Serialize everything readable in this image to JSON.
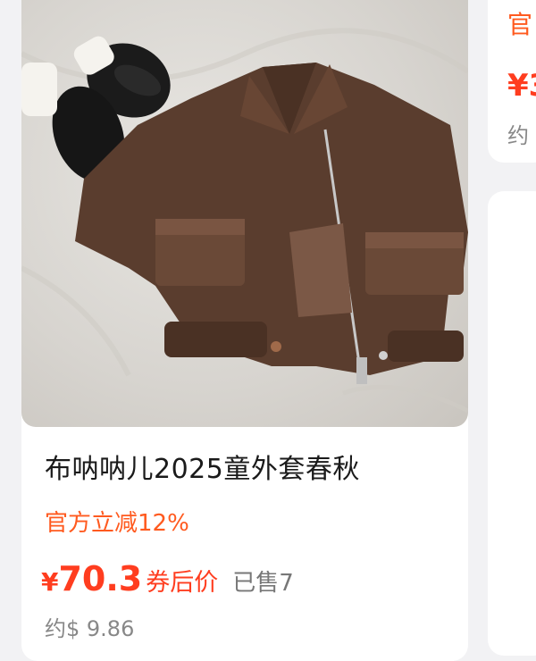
{
  "product": {
    "title": "布呐呐儿2025童外套春秋",
    "promo": "官方立减12%",
    "currency": "¥",
    "price": "70.3",
    "price_tag": "券后价",
    "sold": "已售7",
    "usd_price": "约$ 9.86"
  },
  "next_card": {
    "promo_fragment": "官",
    "price_fragment": "¥3",
    "usd_fragment": "约"
  },
  "colors": {
    "accent_orange": "#ff5a1f",
    "price_red": "#ff3d1f",
    "page_bg": "#f2f2f4"
  }
}
